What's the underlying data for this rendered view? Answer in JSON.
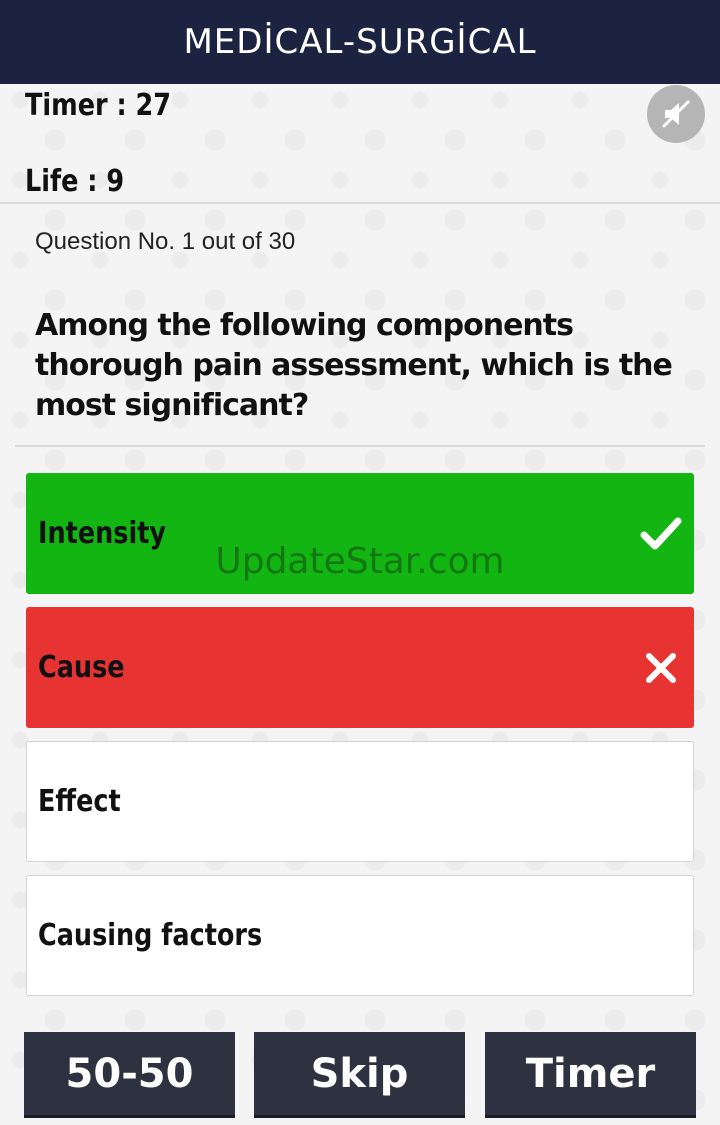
{
  "header": {
    "title": "MEDİCAL-SURGİCAL"
  },
  "status": {
    "timer_text": "Timer  : 27",
    "life_text": "Life : 9"
  },
  "question": {
    "number_text": "Question No. 1 out of 30",
    "text": "Among the following components thorough pain assessment, which is the most significant?"
  },
  "options": [
    {
      "label": "Intensity",
      "state": "correct",
      "icon": "check-icon"
    },
    {
      "label": "Cause",
      "state": "wrong",
      "icon": "close-icon"
    },
    {
      "label": "Effect",
      "state": "neutral"
    },
    {
      "label": "Causing factors",
      "state": "neutral"
    }
  ],
  "watermark": "UpdateStar.com",
  "lifelines": {
    "fifty_label": "50-50",
    "skip_label": "Skip",
    "timer_label": "Timer"
  },
  "colors": {
    "header_bg": "#1c2340",
    "correct": "#13b513",
    "wrong": "#e83333",
    "button_bg": "#2d3140"
  },
  "icons": {
    "sound": "sound-muted-icon"
  }
}
